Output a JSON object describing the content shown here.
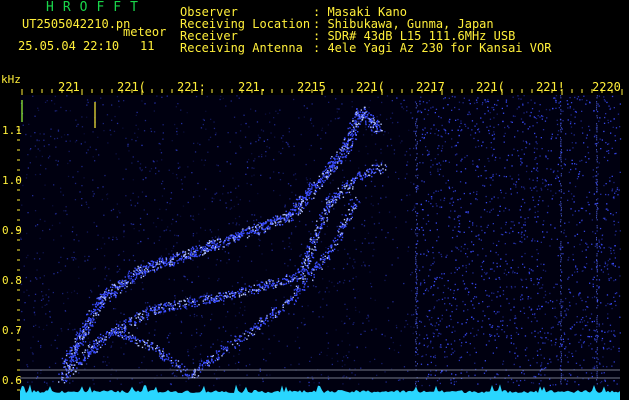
{
  "header": {
    "app_title": "HROFFT",
    "filename": "UT2505042210.pn",
    "meteor_label": "meteor",
    "datetime": "25.05.04 22:10",
    "count": "11",
    "info": [
      {
        "key": "Observer",
        "value": ": Masaki Kano"
      },
      {
        "key": "Receiving Location",
        "value": ": Shibukawa, Gunma, Japan"
      },
      {
        "key": "Receiver",
        "value": ": SDR# 43dB L15 111.6MHz USB"
      },
      {
        "key": "Receiving Antenna",
        "value": ": 4ele Yagi Az 230 for Kansai VOR"
      }
    ]
  },
  "spectrogram": {
    "y_unit": "kHz",
    "y_labels": [
      "1.1",
      "1.0",
      "0.9",
      "0.8",
      "0.7",
      "0.6"
    ],
    "x_labels": [
      "221",
      "221(",
      "221:",
      "221.",
      "2215",
      "221(",
      "2217",
      "221(",
      "221!",
      "2220"
    ],
    "colors": {
      "background": "#000010",
      "dots": "#3a4cff",
      "bright": "#b0c0ff",
      "baseline": "#29d6ff",
      "grid": "#334466",
      "tick": "#ffef3a"
    }
  }
}
